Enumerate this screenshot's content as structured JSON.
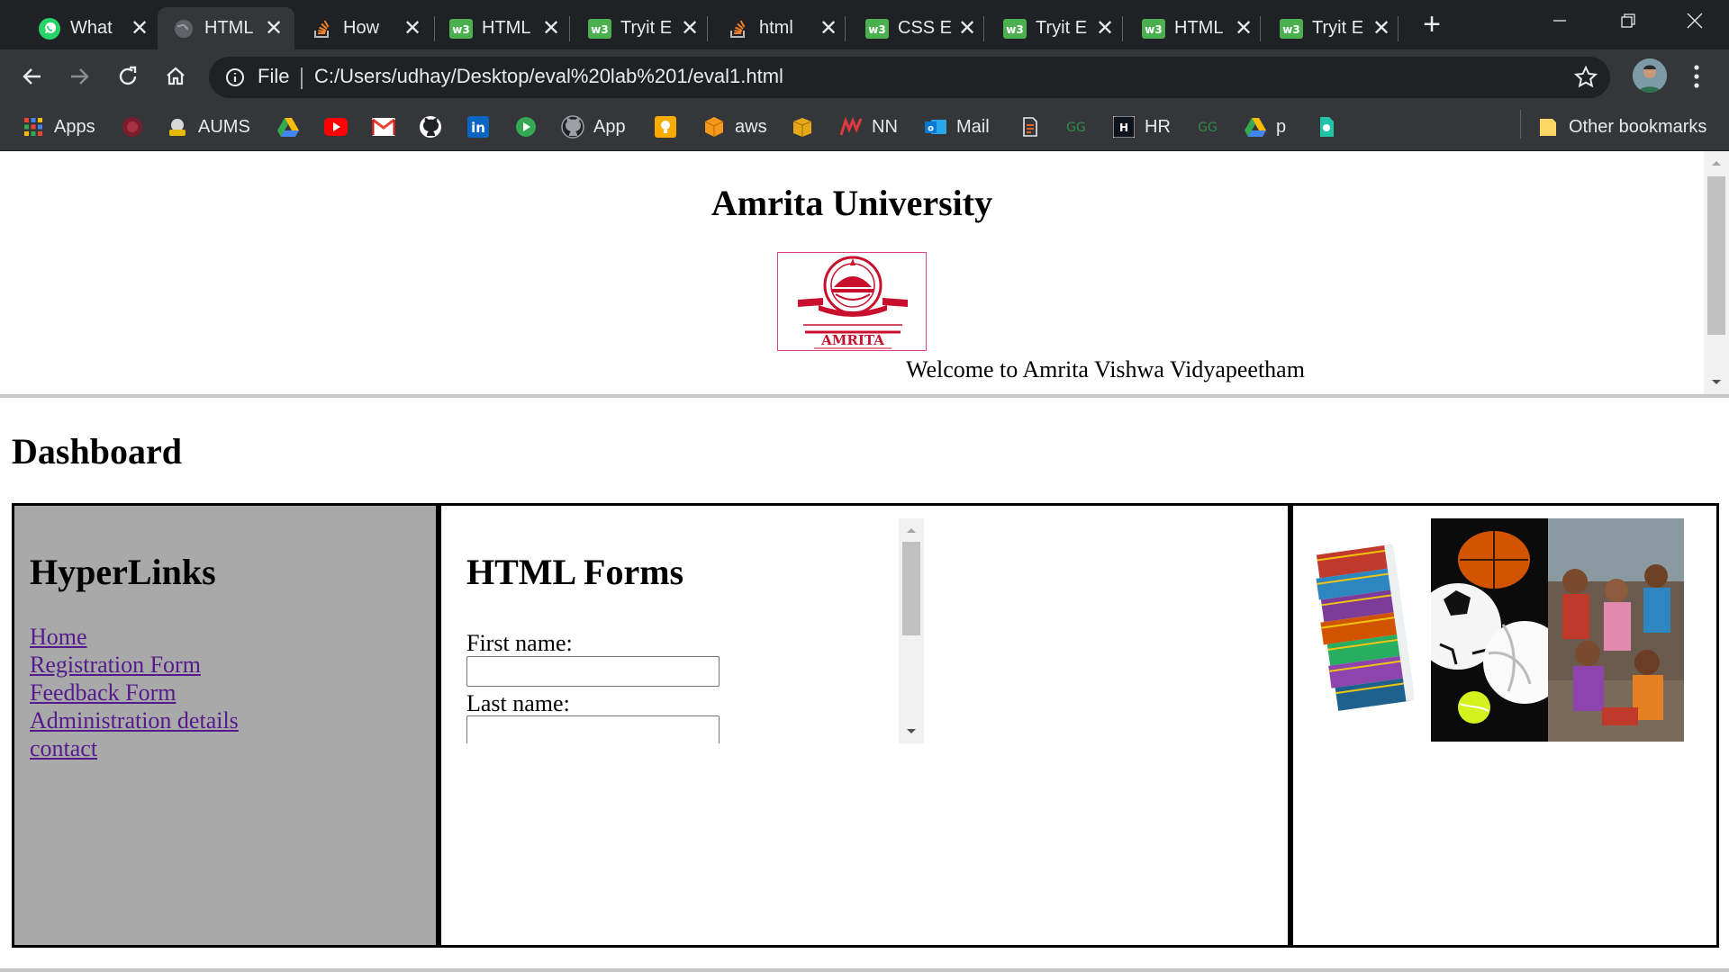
{
  "browser": {
    "tabs": [
      {
        "title": "What",
        "icon": "whatsapp-icon",
        "active": false
      },
      {
        "title": "HTML",
        "icon": "globe-icon",
        "active": true
      },
      {
        "title": "How",
        "icon": "stackoverflow-icon",
        "active": false
      },
      {
        "title": "HTML",
        "icon": "w3schools-icon",
        "active": false
      },
      {
        "title": "Tryit E",
        "icon": "w3schools-icon",
        "active": false
      },
      {
        "title": "html",
        "icon": "stackoverflow-icon",
        "active": false
      },
      {
        "title": "CSS E",
        "icon": "w3schools-icon",
        "active": false
      },
      {
        "title": "Tryit E",
        "icon": "w3schools-icon",
        "active": false
      },
      {
        "title": "HTML",
        "icon": "w3schools-icon",
        "active": false
      },
      {
        "title": "Tryit E",
        "icon": "w3schools-icon",
        "active": false
      }
    ],
    "address": {
      "scheme_label": "File",
      "url": "C:/Users/udhay/Desktop/eval%20lab%201/eval1.html"
    },
    "bookmarks": [
      {
        "label": "Apps",
        "icon": "apps-grid-icon"
      },
      {
        "label": "",
        "icon": "amrita-logo-icon"
      },
      {
        "label": "AUMS",
        "icon": "aums-icon"
      },
      {
        "label": "",
        "icon": "google-drive-icon"
      },
      {
        "label": "",
        "icon": "youtube-icon"
      },
      {
        "label": "",
        "icon": "gmail-icon"
      },
      {
        "label": "",
        "icon": "github-icon"
      },
      {
        "label": "",
        "icon": "linkedin-icon"
      },
      {
        "label": "",
        "icon": "play-icon"
      },
      {
        "label": "App",
        "icon": "github-icon"
      },
      {
        "label": "",
        "icon": "lightbulb-icon"
      },
      {
        "label": "aws",
        "icon": "aws-cube-icon"
      },
      {
        "label": "",
        "icon": "package-icon"
      },
      {
        "label": "NN",
        "icon": "nn-icon"
      },
      {
        "label": "Mail",
        "icon": "outlook-icon"
      },
      {
        "label": "",
        "icon": "hackerearth-icon"
      },
      {
        "label": "",
        "icon": "geeksforgeeks-icon"
      },
      {
        "label": "HR",
        "icon": "hackerrank-icon"
      },
      {
        "label": "",
        "icon": "geeksforgeeks-icon"
      },
      {
        "label": "p",
        "icon": "google-drive-icon"
      },
      {
        "label": "",
        "icon": "bookmark-doc-icon"
      }
    ],
    "other_bookmarks": "Other bookmarks"
  },
  "header": {
    "title": "Amrita University",
    "logo_text": "AMRITA",
    "welcome": "Welcome to Amrita Vishwa Vidyapeetham"
  },
  "dashboard": {
    "title": "Dashboard",
    "links_title": "HyperLinks",
    "links": [
      "Home",
      "Registration Form",
      "Feedback Form",
      "Administration details",
      "contact"
    ],
    "forms_title": "HTML Forms",
    "first_name_label": "First name:",
    "last_name_label": "Last name:",
    "first_name_value": "",
    "last_name_value": ""
  },
  "colors": {
    "chrome_dark": "#202124",
    "chrome_mid": "#35363a",
    "link_visited": "#551a8b",
    "left_panel": "#a9a9a9",
    "logo_red": "#c8102e"
  }
}
